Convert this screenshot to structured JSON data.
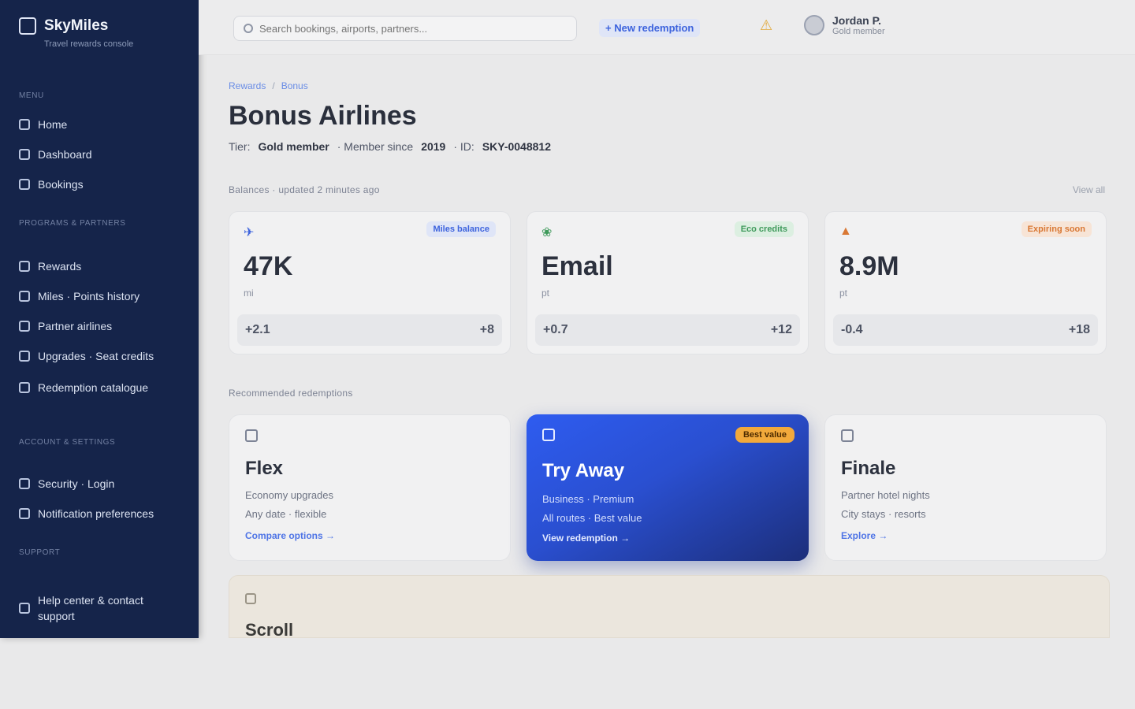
{
  "sidebar": {
    "brand": {
      "name": "SkyMiles",
      "subtitle": "Travel rewards console"
    },
    "sections": [
      {
        "label": "Menu"
      },
      {
        "label": "Programs & partners"
      },
      {
        "label": "Account & settings"
      },
      {
        "label": "Support"
      }
    ],
    "items": [
      {
        "label": "Home"
      },
      {
        "label": "Dashboard"
      },
      {
        "label": "Bookings"
      },
      {
        "label": "Rewards"
      },
      {
        "label": "Miles · Points history"
      },
      {
        "label": "Partner airlines"
      },
      {
        "label": "Upgrades · Seat credits"
      },
      {
        "label": "Redemption catalogue"
      },
      {
        "label": "Security · Login"
      },
      {
        "label": "Notification preferences"
      },
      {
        "label": "Help center & contact support"
      }
    ]
  },
  "topbar": {
    "search_placeholder": "Search bookings, airports, partners...",
    "action_link": "+ New redemption",
    "bell_icon": "bell-icon",
    "user": {
      "name": "Jordan P.",
      "role": "Gold member"
    }
  },
  "breadcrumb": [
    "Rewards",
    "Bonus"
  ],
  "page": {
    "title": "Bonus Airlines",
    "subtitle_prefix": "Tier:",
    "subtitle_tier": "Gold member",
    "subtitle_mid": "· Member since",
    "subtitle_since": "2019",
    "subtitle_id_label": "· ID:",
    "subtitle_id": "SKY-0048812"
  },
  "balances": {
    "label": "Balances · updated 2 minutes ago",
    "aside": "View all",
    "cards": [
      {
        "icon": "plane-icon",
        "badge": "Miles balance",
        "badge_color": "#3d63dd",
        "badge_bg": "#dfe5f7",
        "icon_color": "#3d63dd",
        "value": "47K",
        "caption": "mi",
        "foot_left": "+2.1",
        "foot_right": "+8"
      },
      {
        "icon": "leaf-icon",
        "badge": "Eco credits",
        "badge_color": "#3f9a5b",
        "badge_bg": "#dcefe1",
        "icon_color": "#3f9a5b",
        "value": "Email",
        "caption": "pt",
        "foot_left": "+0.7",
        "foot_right": "+12"
      },
      {
        "icon": "flame-icon",
        "badge": "Expiring soon",
        "badge_color": "#d97834",
        "badge_bg": "#f7e4d6",
        "icon_color": "#d97834",
        "value": "8.9M",
        "caption": "pt",
        "foot_left": "-0.4",
        "foot_right": "+18"
      }
    ]
  },
  "plans": {
    "label": "Recommended redemptions",
    "cards": [
      {
        "name": "Flex",
        "desc": "Economy upgrades\nAny date · flexible",
        "link": "Compare options →",
        "featured": false
      },
      {
        "name": "Try Away",
        "desc": "Business · Premium\nAll routes · Best value",
        "link": "View redemption →",
        "featured": true,
        "tag": "Best value"
      },
      {
        "name": "Finale",
        "desc": "Partner hotel nights\nCity stays · resorts",
        "link": "Explore →",
        "featured": false
      }
    ]
  },
  "bottom_card": {
    "title": "Scroll"
  }
}
